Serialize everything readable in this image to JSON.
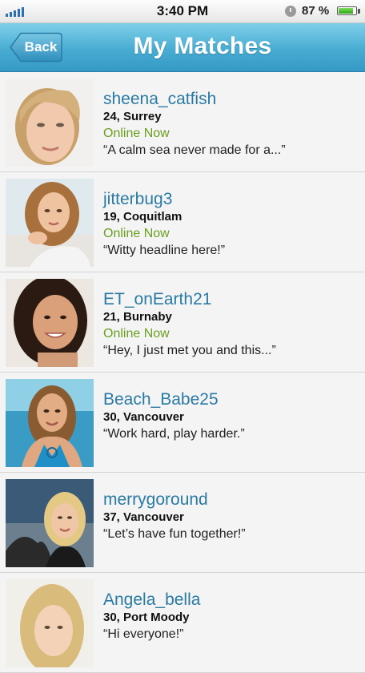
{
  "status_bar": {
    "time": "3:40 PM",
    "battery_percent": "87 %",
    "battery_level": 0.87,
    "icons": [
      "signal-bars-icon",
      "clock-icon",
      "battery-icon"
    ]
  },
  "navbar": {
    "back_label": "Back",
    "title": "My Matches"
  },
  "colors": {
    "username": "#2a7aa3",
    "online": "#6a9e1f",
    "navbar": "#48acd2"
  },
  "matches": [
    {
      "username": "sheena_catfish",
      "age_location": "24, Surrey",
      "status": "Online Now",
      "headline": "“A calm sea never made for a...”"
    },
    {
      "username": "jitterbug3",
      "age_location": "19, Coquitlam",
      "status": "Online Now",
      "headline": "“Witty headline here!”"
    },
    {
      "username": "ET_onEarth21",
      "age_location": "21, Burnaby",
      "status": "Online Now",
      "headline": "“Hey, I just met you and this...”"
    },
    {
      "username": "Beach_Babe25",
      "age_location": "30, Vancouver",
      "status": "",
      "headline": "“Work hard, play harder.”"
    },
    {
      "username": "merrygoround",
      "age_location": "37, Vancouver",
      "status": "",
      "headline": "“Let’s have fun together!”"
    },
    {
      "username": "Angela_bella",
      "age_location": "30, Port Moody",
      "status": "",
      "headline": "“Hi everyone!”"
    }
  ]
}
